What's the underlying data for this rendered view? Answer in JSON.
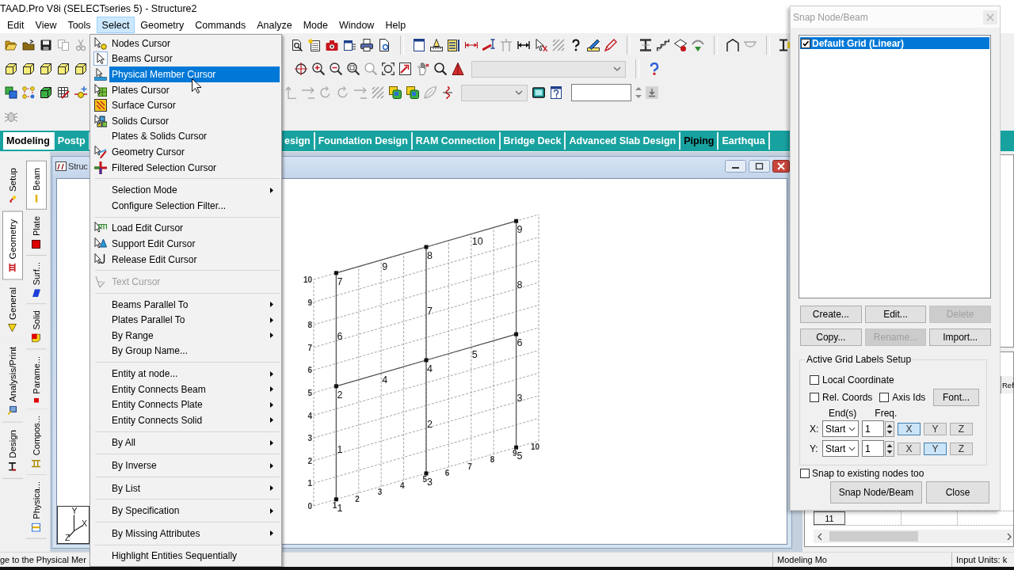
{
  "title_bar": {
    "title": "TAAD.Pro V8i (SELECTseries 5) - Structure2"
  },
  "menu_bar": [
    {
      "label": "Edit",
      "selected": false
    },
    {
      "label": "View",
      "selected": false
    },
    {
      "label": "Tools",
      "selected": false
    },
    {
      "label": "Select",
      "selected": true
    },
    {
      "label": "Geometry",
      "selected": false
    },
    {
      "label": "Commands",
      "selected": false
    },
    {
      "label": "Analyze",
      "selected": false
    },
    {
      "label": "Mode",
      "selected": false
    },
    {
      "label": "Window",
      "selected": false
    },
    {
      "label": "Help",
      "selected": false
    }
  ],
  "select_menu": {
    "groups": [
      [
        {
          "label": "Nodes Cursor",
          "selected": false,
          "checked": false,
          "disabled": false,
          "submenu": false
        },
        {
          "label": "Beams Cursor",
          "selected": false,
          "checked": true,
          "disabled": false,
          "submenu": false
        },
        {
          "label": "Physical Member Cursor",
          "selected": true,
          "checked": false,
          "disabled": false,
          "submenu": false
        },
        {
          "label": "Plates Cursor",
          "selected": false,
          "checked": false,
          "disabled": false,
          "submenu": false
        },
        {
          "label": "Surface Cursor",
          "selected": false,
          "checked": false,
          "disabled": false,
          "submenu": false
        },
        {
          "label": "Solids Cursor",
          "selected": false,
          "checked": false,
          "disabled": false,
          "submenu": false
        },
        {
          "label": "Plates & Solids Cursor",
          "selected": false,
          "checked": false,
          "disabled": false,
          "submenu": false
        },
        {
          "label": "Geometry Cursor",
          "selected": false,
          "checked": false,
          "disabled": false,
          "submenu": false
        },
        {
          "label": "Filtered Selection Cursor",
          "selected": false,
          "checked": false,
          "disabled": false,
          "submenu": false
        }
      ],
      [
        {
          "label": "Selection Mode",
          "selected": false,
          "checked": false,
          "disabled": false,
          "submenu": true
        },
        {
          "label": "Configure Selection Filter...",
          "selected": false,
          "checked": false,
          "disabled": false,
          "submenu": false
        }
      ],
      [
        {
          "label": "Load Edit Cursor",
          "selected": false,
          "checked": false,
          "disabled": false,
          "submenu": false
        },
        {
          "label": "Support Edit Cursor",
          "selected": false,
          "checked": false,
          "disabled": false,
          "submenu": false
        },
        {
          "label": "Release Edit Cursor",
          "selected": false,
          "checked": false,
          "disabled": false,
          "submenu": false
        }
      ],
      [
        {
          "label": "Text Cursor",
          "selected": false,
          "checked": false,
          "disabled": true,
          "submenu": false
        }
      ],
      [
        {
          "label": "Beams Parallel To",
          "selected": false,
          "checked": false,
          "disabled": false,
          "submenu": true
        },
        {
          "label": "Plates Parallel To",
          "selected": false,
          "checked": false,
          "disabled": false,
          "submenu": true
        },
        {
          "label": "By Range",
          "selected": false,
          "checked": false,
          "disabled": false,
          "submenu": true
        },
        {
          "label": "By Group Name...",
          "selected": false,
          "checked": false,
          "disabled": false,
          "submenu": false
        }
      ],
      [
        {
          "label": "Entity at node...",
          "selected": false,
          "checked": false,
          "disabled": false,
          "submenu": true
        },
        {
          "label": "Entity Connects Beam",
          "selected": false,
          "checked": false,
          "disabled": false,
          "submenu": true
        },
        {
          "label": "Entity Connects Plate",
          "selected": false,
          "checked": false,
          "disabled": false,
          "submenu": true
        },
        {
          "label": "Entity Connects Solid",
          "selected": false,
          "checked": false,
          "disabled": false,
          "submenu": true
        }
      ],
      [
        {
          "label": "By All",
          "selected": false,
          "checked": false,
          "disabled": false,
          "submenu": true
        }
      ],
      [
        {
          "label": "By Inverse",
          "selected": false,
          "checked": false,
          "disabled": false,
          "submenu": true
        }
      ],
      [
        {
          "label": "By List",
          "selected": false,
          "checked": false,
          "disabled": false,
          "submenu": true
        }
      ],
      [
        {
          "label": "By Specification",
          "selected": false,
          "checked": false,
          "disabled": false,
          "submenu": true
        }
      ],
      [
        {
          "label": "By Missing Attributes",
          "selected": false,
          "checked": false,
          "disabled": false,
          "submenu": true
        }
      ],
      [
        {
          "label": "Highlight Entities Sequentially",
          "selected": false,
          "checked": false,
          "disabled": false,
          "submenu": false
        }
      ]
    ]
  },
  "module_tabs": [
    {
      "label": "Modeling",
      "selected": true,
      "highlighted": false
    },
    {
      "label": "Postp",
      "selected": false,
      "highlighted": false
    },
    {
      "label": "esign",
      "selected": false,
      "highlighted": false
    },
    {
      "label": "Foundation Design",
      "selected": false,
      "highlighted": false
    },
    {
      "label": "RAM Connection",
      "selected": false,
      "highlighted": false
    },
    {
      "label": "Bridge Deck",
      "selected": false,
      "highlighted": false
    },
    {
      "label": "Advanced Slab Design",
      "selected": false,
      "highlighted": false
    },
    {
      "label": "Piping",
      "selected": false,
      "highlighted": true
    },
    {
      "label": "Earthqua",
      "selected": false,
      "highlighted": false
    }
  ],
  "page_tabs": [
    {
      "label": "Setup",
      "selected": false
    },
    {
      "label": "Geometry",
      "selected": true
    },
    {
      "label": "General",
      "selected": false
    },
    {
      "label": "Analysis/Print",
      "selected": false
    },
    {
      "label": "Design",
      "selected": false
    }
  ],
  "sub_tabs": [
    {
      "label": "Beam",
      "selected": true
    },
    {
      "label": "Plate",
      "selected": false
    },
    {
      "label": "Surf...",
      "selected": false
    },
    {
      "label": "Solid",
      "selected": false
    },
    {
      "label": "Parame...",
      "selected": false
    },
    {
      "label": "Compos...",
      "selected": false
    },
    {
      "label": "Physica...",
      "selected": false
    }
  ],
  "structure_window": {
    "title": "Struc",
    "triad": [
      "Y",
      "X",
      "Z"
    ],
    "model": {
      "y_grid_labels": [
        "10",
        "9",
        "8",
        "7",
        "6",
        "5",
        "4",
        "3",
        "2",
        "1",
        "0"
      ],
      "x_grid_labels": [
        "1",
        "2",
        "3",
        "4",
        "5",
        "6",
        "7",
        "8",
        "9",
        "10"
      ],
      "node_labels": [
        "7",
        "8",
        "9",
        "2",
        "4",
        "6",
        "1",
        "3",
        "5"
      ],
      "beam_labels": [
        "9",
        "10",
        "6",
        "7",
        "8",
        "4",
        "5",
        "1",
        "2",
        "3"
      ]
    }
  },
  "data_table": {
    "column_header": "Ref",
    "row_label": "11"
  },
  "status_bar": {
    "message": "ge to the Physical Mer",
    "mode": "Modeling Mo",
    "units": "Input Units: k"
  },
  "snap_dialog": {
    "title": "Snap Node/Beam",
    "grids": [
      {
        "label": "Default Grid (Linear)",
        "checked": true,
        "selected": true
      }
    ],
    "buttons": [
      {
        "label": "Create...",
        "disabled": false
      },
      {
        "label": "Edit...",
        "disabled": false
      },
      {
        "label": "Delete",
        "disabled": true
      },
      {
        "label": "Copy...",
        "disabled": false
      },
      {
        "label": "Rename...",
        "disabled": true
      },
      {
        "label": "Import...",
        "disabled": false
      }
    ],
    "grid_labels_setup": {
      "title": "Active Grid Labels Setup",
      "options": [
        {
          "label": "Local Coordinate",
          "checked": false
        },
        {
          "label": "Rel. Coords",
          "checked": false
        },
        {
          "label": "Axis Ids",
          "checked": false
        }
      ],
      "font_button": "Font...",
      "ends_header": "End(s)",
      "freq_header": "Freq.",
      "axes": [
        {
          "label": "X:",
          "end": "Start",
          "freq": "1",
          "toggles": [
            {
              "label": "X",
              "selected": true
            },
            {
              "label": "Y",
              "selected": false
            },
            {
              "label": "Z",
              "selected": false
            }
          ]
        },
        {
          "label": "Y:",
          "end": "Start",
          "freq": "1",
          "toggles": [
            {
              "label": "X",
              "selected": false
            },
            {
              "label": "Y",
              "selected": true
            },
            {
              "label": "Z",
              "selected": false
            }
          ]
        }
      ]
    },
    "snap_existing": {
      "label": "Snap to existing nodes too",
      "checked": false
    },
    "footer_buttons": [
      "Snap Node/Beam",
      "Close"
    ]
  }
}
